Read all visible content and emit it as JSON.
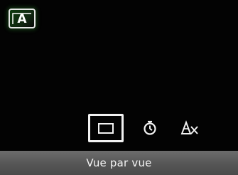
{
  "mode_badge": {
    "letter": "A",
    "icon": "auto-mode-icon",
    "glow_color": "#2e7d32"
  },
  "drive_modes": {
    "items": [
      {
        "name": "single-shot",
        "icon": "single-frame-icon",
        "selected": true
      },
      {
        "name": "self-timer",
        "icon": "self-timer-icon",
        "selected": false
      },
      {
        "name": "remote",
        "icon": "remote-off-icon",
        "selected": false
      }
    ]
  },
  "label": {
    "text": "Vue par vue"
  },
  "colors": {
    "background": "#030303",
    "foreground": "#f2f2f2",
    "label_bar": "#5a5a5a"
  }
}
